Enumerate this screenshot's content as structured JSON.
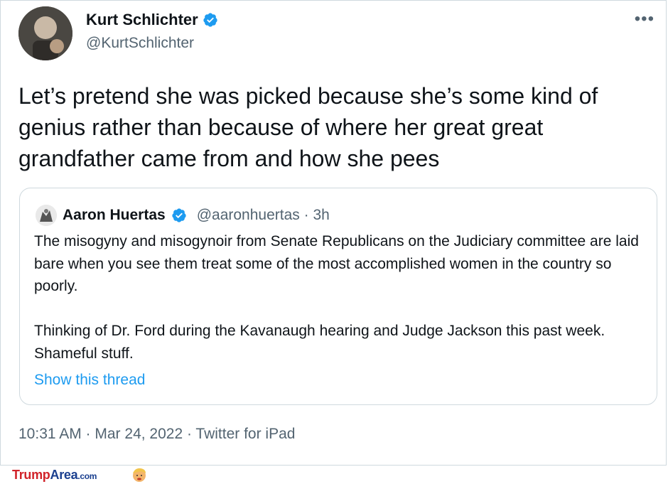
{
  "author": {
    "display_name": "Kurt Schlichter",
    "handle": "@KurtSchlichter",
    "verified": true
  },
  "more_icon": "more-horizontal-icon",
  "tweet": {
    "text": "Let’s pretend she was picked because she’s some kind of genius rather than because of where her great great grandfather came from and how she pees",
    "timestamp": "10:31 AM · Mar 24, 2022 · Twitter for iPad"
  },
  "quote": {
    "display_name": "Aaron Huertas",
    "handle_time": "@aaronhuertas · 3h",
    "verified": true,
    "text": "The misogyny and misogynoir from Senate Republicans on the Judiciary committee are laid bare when you see them treat some of the most accomplished women in the country so poorly.\n\nThinking of Dr. Ford during the Kavanaugh hearing and Judge Jackson this past week. Shameful stuff.",
    "show_thread": "Show this thread"
  },
  "footer": {
    "logo_part1": "Trump",
    "logo_part2": "Area",
    "logo_part3": ".com"
  },
  "colors": {
    "accent": "#1d9bf0",
    "secondary_text": "#536471",
    "border": "#cfd9de",
    "logo_red": "#d1232a",
    "logo_blue": "#1a3f8f"
  }
}
